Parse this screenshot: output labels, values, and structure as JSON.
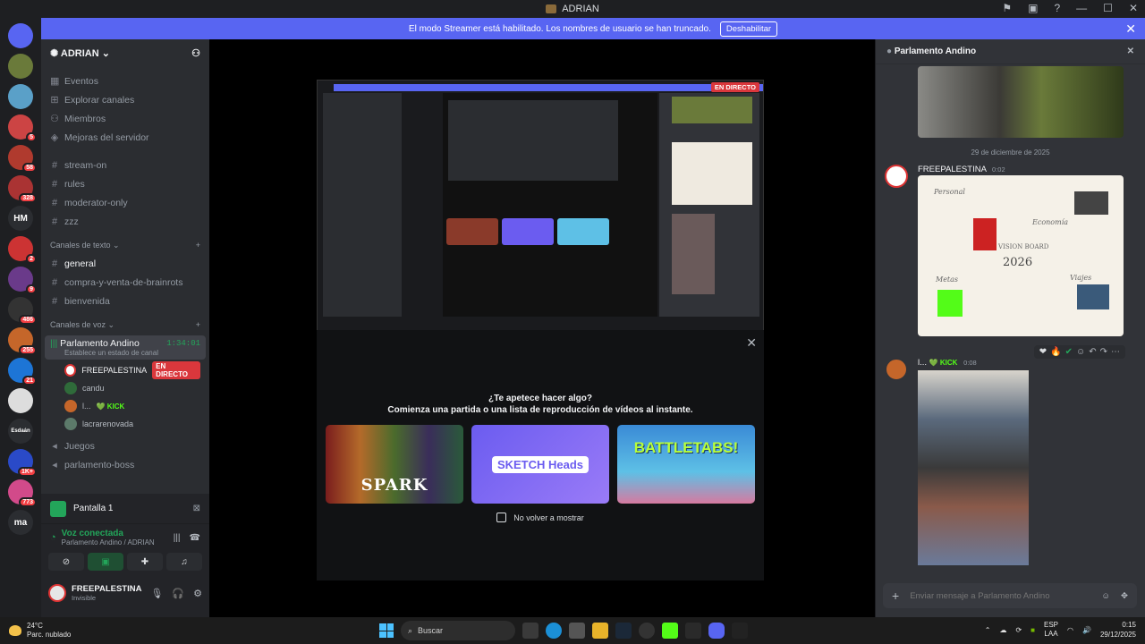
{
  "window": {
    "title": "ADRIAN"
  },
  "banner": {
    "message": "El modo Streamer está habilitado. Los nombres de usuario se han truncado.",
    "disable_label": "Deshabilitar"
  },
  "servers": [
    {
      "label": "",
      "badge": "",
      "color": "#5865f2"
    },
    {
      "label": "",
      "badge": "",
      "color": "#6a7a3a"
    },
    {
      "label": "",
      "badge": "",
      "color": "#5aa0c8"
    },
    {
      "label": "",
      "badge": "5",
      "color": "#c44"
    },
    {
      "label": "",
      "badge": "58",
      "color": "#b03a2e"
    },
    {
      "label": "",
      "badge": "328",
      "color": "#a33"
    },
    {
      "label": "HM",
      "badge": "",
      "color": "#2b2d31"
    },
    {
      "label": "",
      "badge": "2",
      "color": "#c33"
    },
    {
      "label": "",
      "badge": "9",
      "color": "#6a3a8a"
    },
    {
      "label": "",
      "badge": "486",
      "color": "#333"
    },
    {
      "label": "",
      "badge": "255",
      "color": "#c5662a"
    },
    {
      "label": "",
      "badge": "21",
      "color": "#1d75d6"
    },
    {
      "label": "",
      "badge": "",
      "color": "#ddd"
    },
    {
      "label": "Esdaán",
      "badge": "",
      "color": "#2b2d31"
    },
    {
      "label": "",
      "badge": "1K+",
      "color": "#2a4ac8"
    },
    {
      "label": "",
      "badge": "773",
      "color": "#d24a8a"
    },
    {
      "label": "ma",
      "badge": "",
      "color": "#2b2d31"
    }
  ],
  "guild": {
    "name": "ADRIAN"
  },
  "nav": [
    {
      "label": "Eventos",
      "icon": "calendar-icon"
    },
    {
      "label": "Explorar canales",
      "icon": "explore-icon"
    },
    {
      "label": "Miembros",
      "icon": "members-icon"
    },
    {
      "label": "Mejoras del servidor",
      "icon": "boost-icon"
    }
  ],
  "top_channels": [
    "stream-on",
    "rules",
    "moderator-only",
    "zzz"
  ],
  "text_category": "Canales de texto",
  "text_channels": [
    "general",
    "compra-y-venta-de-brainrots",
    "bienvenida"
  ],
  "voice_category": "Canales de voz",
  "voice_channel": {
    "name": "Parlamento Andino",
    "timer": "1:34:01",
    "status": "Establece un estado de canal"
  },
  "voice_users": [
    {
      "name": "FREEPALESTINA",
      "tag": "EN DIRECTO"
    },
    {
      "name": "candu",
      "tag": ""
    },
    {
      "name": "l...",
      "tag": "KICK"
    },
    {
      "name": "lacrarenovada",
      "tag": ""
    }
  ],
  "other_voice": [
    "Juegos",
    "parlamento-boss"
  ],
  "screen_share": {
    "label": "Pantalla 1"
  },
  "voice_connection": {
    "title": "Voz conectada",
    "subtitle": "Parlamento Andino / ADRIAN"
  },
  "user": {
    "name": "FREEPALESTINA",
    "status": "Invisible"
  },
  "stream": {
    "live_label": "EN DIRECTO"
  },
  "activity": {
    "title": "¿Te apetece hacer algo?",
    "subtitle": "Comienza una partida o una lista de reproducción de vídeos al instante.",
    "cards": [
      "SPARK",
      "SKETCH Heads",
      "BATTLETABS!"
    ],
    "dont_show": "No volver a mostrar"
  },
  "chat": {
    "channel": "Parlamento Andino",
    "date_divider": "29 de diciembre de 2025",
    "messages": [
      {
        "author": "FREEPALESTINA",
        "time": "0:02",
        "board": {
          "year": "2026",
          "title": "VISION BOARD",
          "labels": [
            "Personal",
            "Economía",
            "Metas",
            "Viajes"
          ]
        }
      },
      {
        "author": "l...",
        "tag": "KICK",
        "time": "0:08"
      }
    ],
    "input_placeholder": "Enviar mensaje a Parlamento Andino"
  },
  "taskbar": {
    "weather_temp": "24°C",
    "weather_desc": "Parc. nublado",
    "search_placeholder": "Buscar",
    "lang": "ESP",
    "lang_sub": "LAA",
    "time": "0:15",
    "date": "29/12/2025"
  }
}
